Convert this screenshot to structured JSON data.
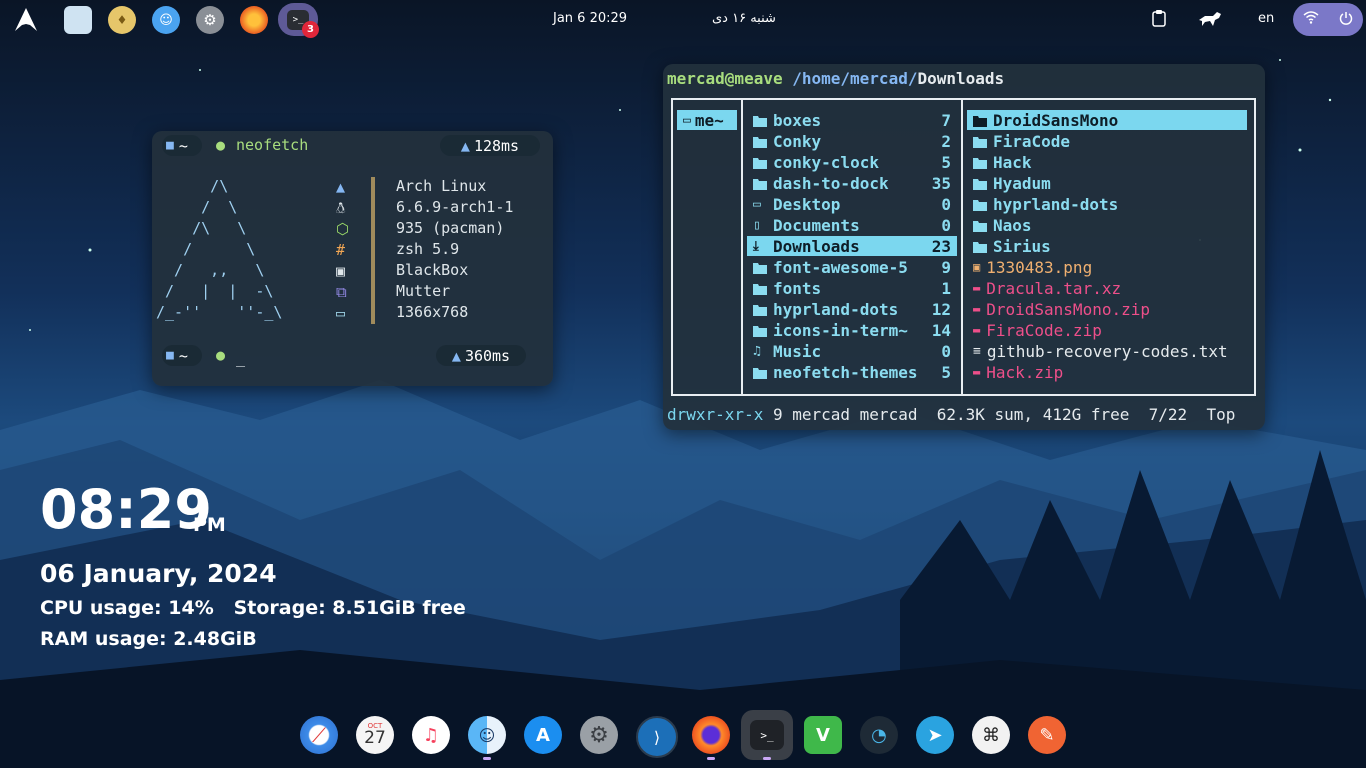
{
  "topbar": {
    "clock": "Jan 6  20:29",
    "persian_date": "شنبه ۱۶ دی",
    "lang": "en",
    "notification_count": "3"
  },
  "neofetch": {
    "prompt_dir": "~",
    "command": "neofetch",
    "time_top": "128ms",
    "ascii": [
      "      /\\",
      "     /  \\",
      "    /\\   \\",
      "   /      \\",
      "  /   ,,   \\",
      " /   |  |  -\\",
      "/_-''    ''-_\\"
    ],
    "info": [
      "Arch Linux",
      "6.6.9-arch1-1",
      "935 (pacman)",
      "zsh 5.9",
      "BlackBox",
      "Mutter",
      "1366x768"
    ],
    "prompt2_dir": "~",
    "cursor": "_",
    "time_bottom": "360ms"
  },
  "ranger": {
    "user_host": "mercad@meave",
    "path": "/home/mercad/",
    "current": "Downloads",
    "parent": [
      {
        "name": "me~"
      }
    ],
    "middle": [
      {
        "name": "boxes",
        "count": "7"
      },
      {
        "name": "Conky",
        "count": "2"
      },
      {
        "name": "conky-clock",
        "count": "5"
      },
      {
        "name": "dash-to-dock",
        "count": "35"
      },
      {
        "name": "Desktop",
        "count": "0"
      },
      {
        "name": "Documents",
        "count": "0"
      },
      {
        "name": "Downloads",
        "count": "23"
      },
      {
        "name": "font-awesome-5",
        "count": "9"
      },
      {
        "name": "fonts",
        "count": "1"
      },
      {
        "name": "hyprland-dots",
        "count": "12"
      },
      {
        "name": "icons-in-term~",
        "count": "14"
      },
      {
        "name": "Music",
        "count": "0"
      },
      {
        "name": "neofetch-themes",
        "count": "5"
      }
    ],
    "right": [
      {
        "name": "DroidSansMono"
      },
      {
        "name": "FiraCode"
      },
      {
        "name": "Hack"
      },
      {
        "name": "Hyadum"
      },
      {
        "name": "hyprland-dots"
      },
      {
        "name": "Naos"
      },
      {
        "name": "Sirius"
      },
      {
        "name": "1330483.png"
      },
      {
        "name": "Dracula.tar.xz"
      },
      {
        "name": "DroidSansMono.zip"
      },
      {
        "name": "FiraCode.zip"
      },
      {
        "name": "github-recovery-codes.txt"
      },
      {
        "name": "Hack.zip"
      }
    ],
    "status": {
      "perms": "drwxr-xr-x",
      "owner": "9 mercad mercad",
      "summary": "62.3K sum, 412G free",
      "position": "7/22",
      "scroll": "Top"
    }
  },
  "conky": {
    "time": "08:29",
    "ampm": "PM",
    "date": "06 January, 2024",
    "line1": "CPU usage: 14%   Storage: 8.51GiB free",
    "line2": "RAM usage: 2.48GiB"
  },
  "dock": {
    "items": [
      "safari-icon",
      "calendar-icon",
      "music-icon",
      "finder-icon",
      "app-store-icon",
      "system-preferences-icon",
      "vscode-icon",
      "firefox-icon",
      "terminal-icon",
      "vim-icon",
      "speedometer-icon",
      "telegram-icon",
      "command-icon",
      "pencil-icon"
    ],
    "calendar_month": "OCT",
    "calendar_day": "27"
  },
  "colors": {
    "accent": "#7bd7ef",
    "pink": "#ee4f8a",
    "green": "#a8dd7e",
    "pill": "#7b78c8"
  }
}
